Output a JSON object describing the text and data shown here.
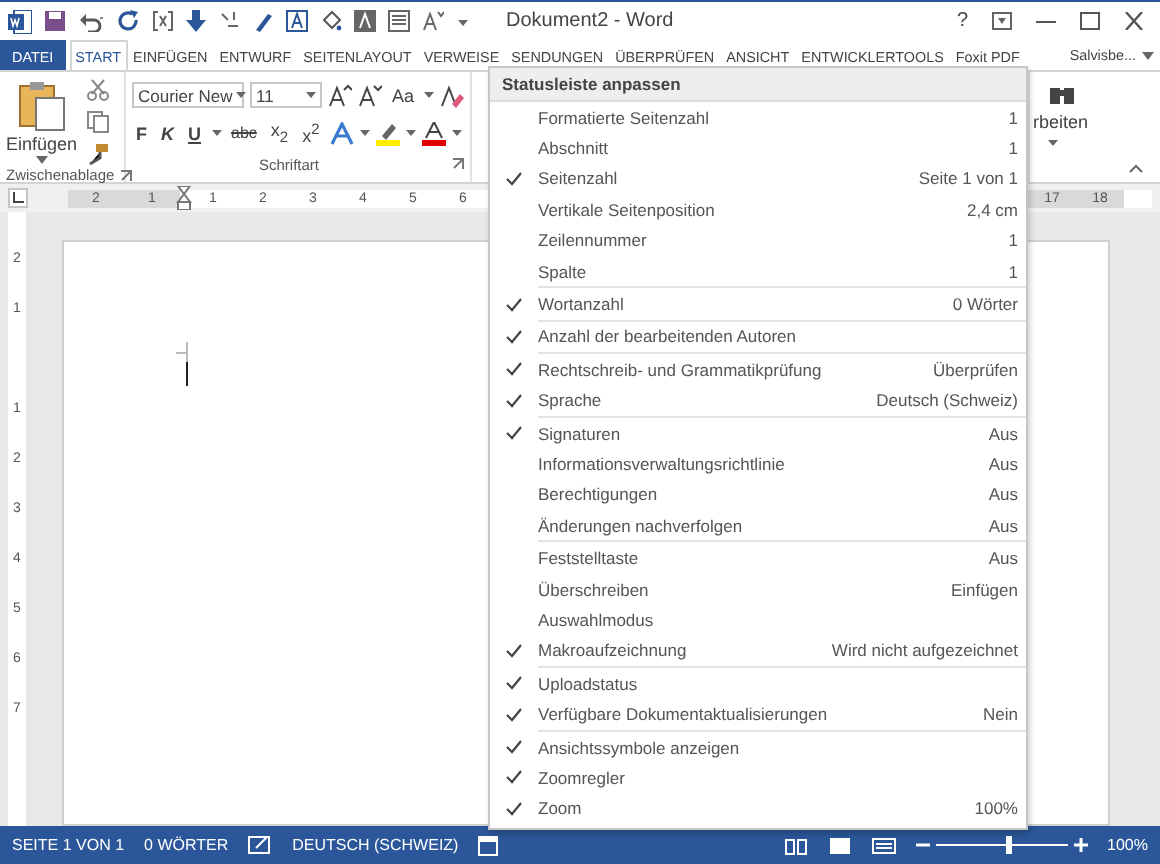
{
  "window": {
    "title": "Dokument2 - Word",
    "help": "?"
  },
  "tabs": [
    {
      "label": "DATEI",
      "kind": "file",
      "selected": false
    },
    {
      "label": "START",
      "kind": "tab",
      "selected": true
    },
    {
      "label": "EINFÜGEN",
      "kind": "tab",
      "selected": false
    },
    {
      "label": "ENTWURF",
      "kind": "tab",
      "selected": false
    },
    {
      "label": "SEITENLAYOUT",
      "kind": "tab",
      "selected": false
    },
    {
      "label": "VERWEISE",
      "kind": "tab",
      "selected": false
    },
    {
      "label": "SENDUNGEN",
      "kind": "tab",
      "selected": false
    },
    {
      "label": "ÜBERPRÜFEN",
      "kind": "tab",
      "selected": false
    },
    {
      "label": "ANSICHT",
      "kind": "tab",
      "selected": false
    },
    {
      "label": "ENTWICKLERTOOLS",
      "kind": "tab",
      "selected": false
    },
    {
      "label": "Foxit PDF",
      "kind": "tab",
      "selected": false
    }
  ],
  "account": "Salvisbe...",
  "ribbon": {
    "clipboard": {
      "title": "Zwischenablage",
      "paste_label": "Einfügen"
    },
    "font": {
      "title": "Schriftart",
      "font_name": "Courier New",
      "font_size": "11",
      "change_case": "Aa",
      "format_buttons": [
        {
          "label": "F",
          "kind": "bold"
        },
        {
          "label": "K",
          "kind": "italic"
        },
        {
          "label": "U",
          "kind": "underline"
        },
        {
          "label": "abc",
          "kind": "strike"
        },
        {
          "label": "x$_{2}$",
          "kind": "plain"
        },
        {
          "label": "x$^{2}$",
          "kind": "plain"
        }
      ]
    },
    "editing": {
      "label": "rbeiten"
    }
  },
  "ruler": {
    "left_labels": [
      "2",
      "1"
    ],
    "labels": [
      "1",
      "2",
      "3",
      "4",
      "5",
      "6"
    ],
    "right_labels": [
      "17",
      "18"
    ],
    "vertical_labels": [
      "2",
      "1",
      "1",
      "2",
      "3",
      "4",
      "5",
      "6",
      "7"
    ]
  },
  "menu": {
    "title": "Statusleiste anpassen",
    "groups": [
      [
        {
          "label": "Formatierte Seitenzahl",
          "value": "1",
          "checked": false
        },
        {
          "label": "Abschnitt",
          "value": "1",
          "checked": false
        },
        {
          "label": "Seitenzahl",
          "value": "Seite 1 von 1",
          "checked": true
        },
        {
          "label": "Vertikale Seitenposition",
          "value": "2,4 cm",
          "checked": false
        },
        {
          "label": "Zeilennummer",
          "value": "1",
          "checked": false
        },
        {
          "label": "Spalte",
          "value": "1",
          "checked": false
        }
      ],
      [
        {
          "label": "Wortanzahl",
          "value": "0 Wörter",
          "checked": true
        }
      ],
      [
        {
          "label": "Anzahl der bearbeitenden Autoren",
          "checked": true
        }
      ],
      [
        {
          "label": "Rechtschreib- und Grammatikprüfung",
          "value": "Überprüfen",
          "checked": true
        },
        {
          "label": "Sprache",
          "value": "Deutsch (Schweiz)",
          "checked": true
        }
      ],
      [
        {
          "label": "Signaturen",
          "value": "Aus",
          "checked": true
        },
        {
          "label": "Informationsverwaltungsrichtlinie",
          "value": "Aus",
          "checked": false
        },
        {
          "label": "Berechtigungen",
          "value": "Aus",
          "checked": false
        },
        {
          "label": "Änderungen nachverfolgen",
          "value": "Aus",
          "checked": false
        }
      ],
      [
        {
          "label": "Feststelltaste",
          "value": "Aus",
          "checked": false
        },
        {
          "label": "Überschreiben",
          "value": "Einfügen",
          "checked": false
        },
        {
          "label": "Auswahlmodus",
          "checked": false
        },
        {
          "label": "Makroaufzeichnung",
          "value": "Wird nicht aufgezeichnet",
          "checked": true
        }
      ],
      [
        {
          "label": "Uploadstatus",
          "checked": true
        },
        {
          "label": "Verfügbare Dokumentaktualisierungen",
          "value": "Nein",
          "checked": true
        }
      ],
      [
        {
          "label": "Ansichtssymbole anzeigen",
          "checked": true
        },
        {
          "label": "Zoomregler",
          "checked": true
        },
        {
          "label": "Zoom",
          "value": "100%",
          "checked": true
        }
      ]
    ]
  },
  "status_bar": {
    "page": "SEITE 1 VON 1",
    "words": "0 WÖRTER",
    "language": "DEUTSCH (SCHWEIZ)",
    "zoom": "100%",
    "zoom_slider": {
      "level": 0.55
    }
  }
}
